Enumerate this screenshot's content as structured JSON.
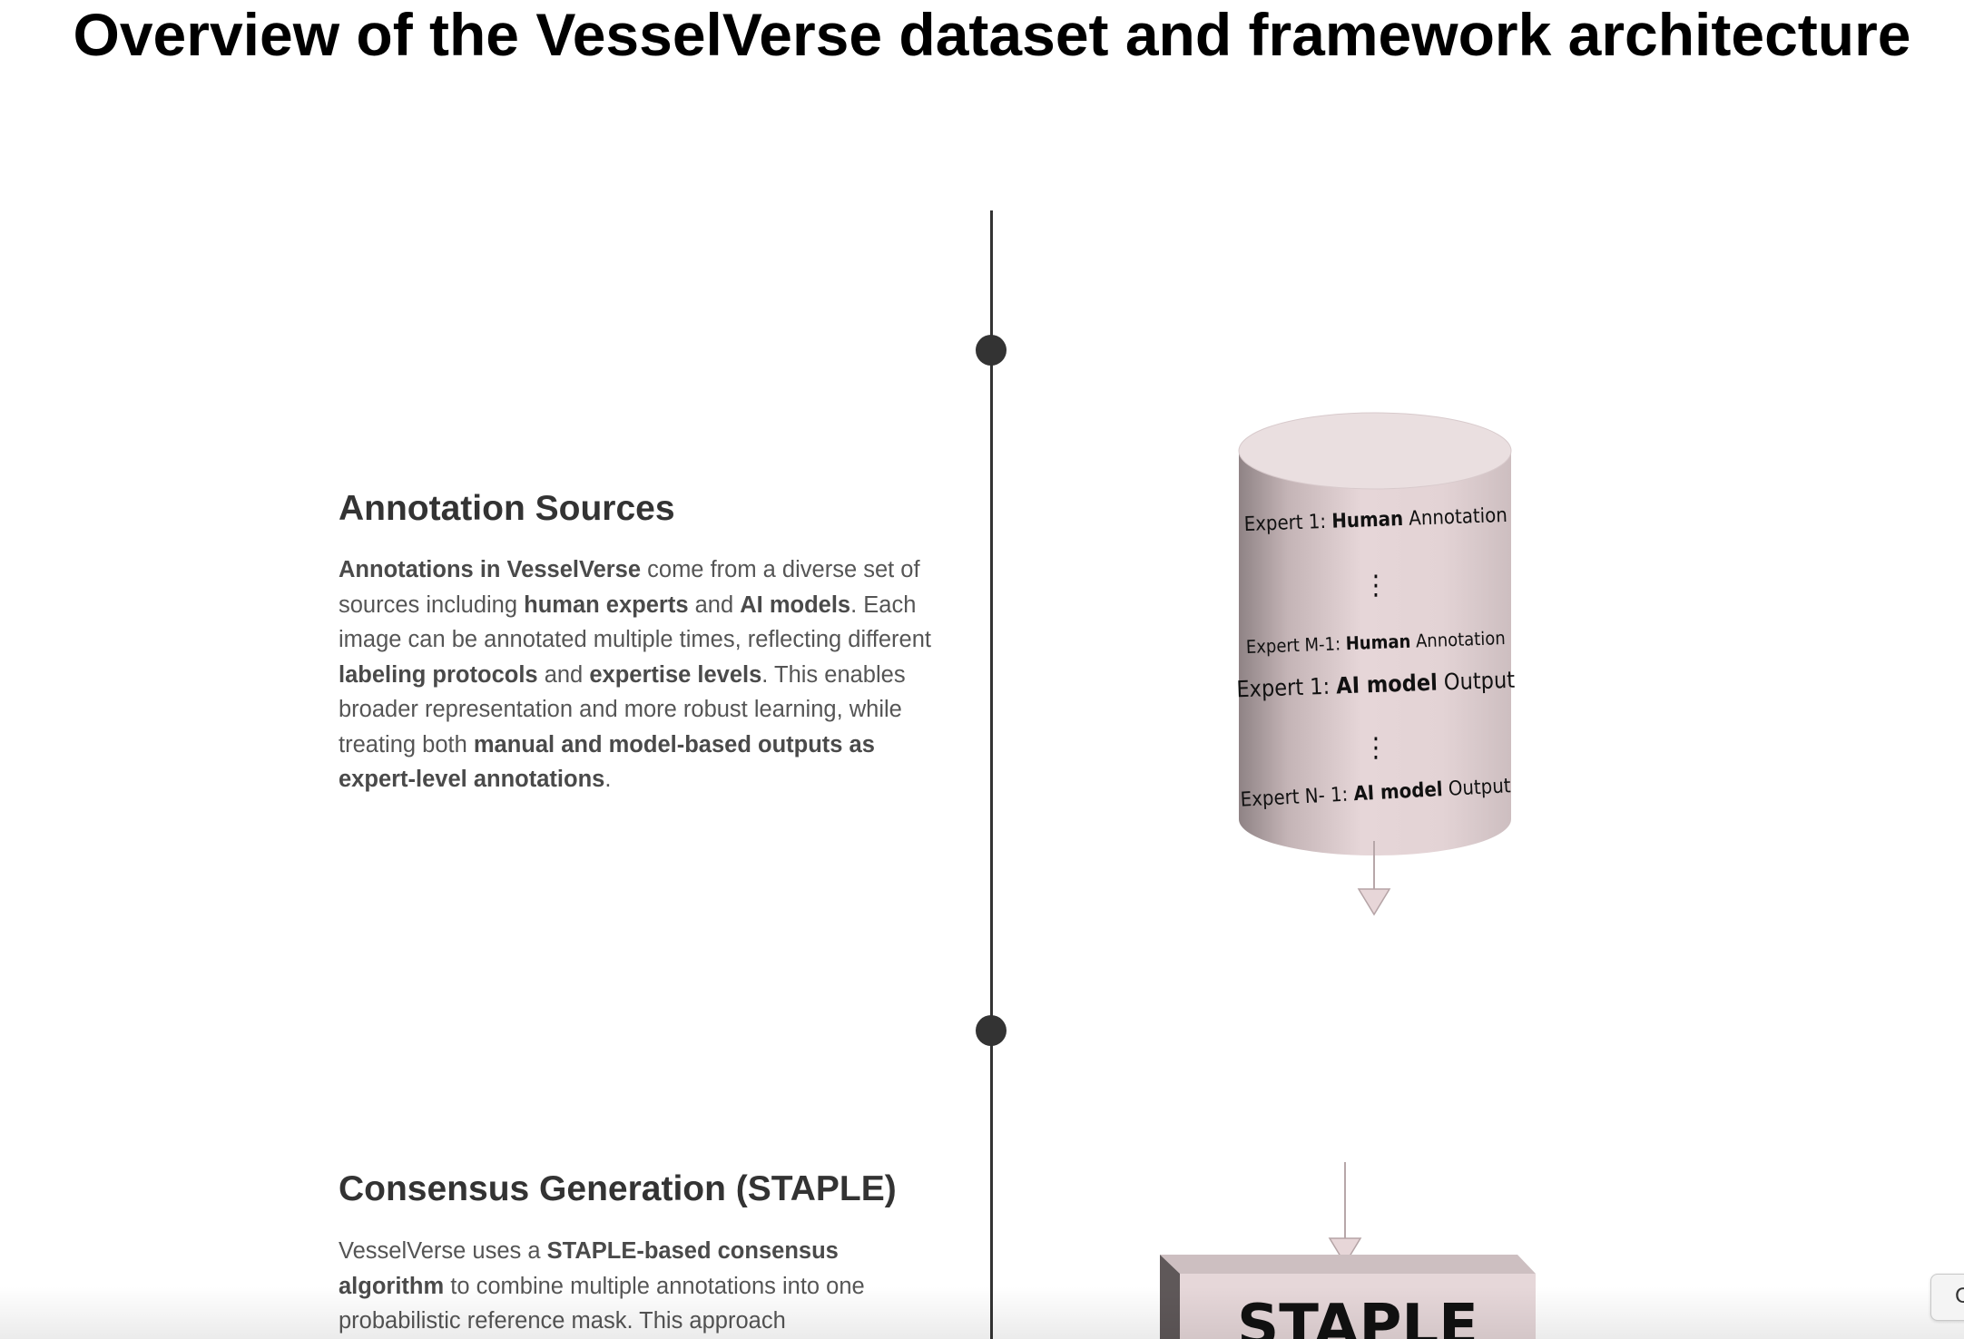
{
  "page": {
    "title": "Overview of the VesselVerse dataset and framework architecture"
  },
  "sections": [
    {
      "heading": "Annotation Sources",
      "text": [
        {
          "t": "Annotations in VesselVerse",
          "b": true
        },
        {
          "t": " come from a diverse set of sources including ",
          "b": false
        },
        {
          "t": "human experts",
          "b": true
        },
        {
          "t": " and ",
          "b": false
        },
        {
          "t": "AI models",
          "b": true
        },
        {
          "t": ". Each image can be annotated multiple times, reflecting different ",
          "b": false
        },
        {
          "t": "labeling protocols",
          "b": true
        },
        {
          "t": " and ",
          "b": false
        },
        {
          "t": "expertise levels",
          "b": true
        },
        {
          "t": ". This enables broader representation and more robust learning, while treating both ",
          "b": false
        },
        {
          "t": "manual and model-based outputs as expert-level annotations",
          "b": true
        },
        {
          "t": ".",
          "b": false
        }
      ]
    },
    {
      "heading": "Consensus Generation (STAPLE)",
      "text": [
        {
          "t": "VesselVerse uses a ",
          "b": false
        },
        {
          "t": "STAPLE-based consensus algorithm",
          "b": true
        },
        {
          "t": " to combine multiple annotations into one probabilistic reference mask. This approach",
          "b": false
        }
      ]
    }
  ],
  "figure": {
    "cylinder_rows": [
      {
        "prefix": "Expert 1: ",
        "bold": "Human",
        "suffix": " Annotation"
      },
      {
        "prefix": "⋮",
        "bold": "",
        "suffix": ""
      },
      {
        "prefix": "Expert M-1: ",
        "bold": "Human",
        "suffix": " Annotation"
      },
      {
        "prefix": "Expert 1: ",
        "bold": "AI model",
        "suffix": " Output"
      },
      {
        "prefix": "⋮",
        "bold": "",
        "suffix": ""
      },
      {
        "prefix": "Expert N- 1: ",
        "bold": "AI model",
        "suffix": " Output"
      }
    ],
    "block_label": "STAPLE",
    "fill_color": "#e8d9db",
    "arrow_color": "#dcc9cc"
  },
  "corner_button": {
    "label": "C"
  }
}
